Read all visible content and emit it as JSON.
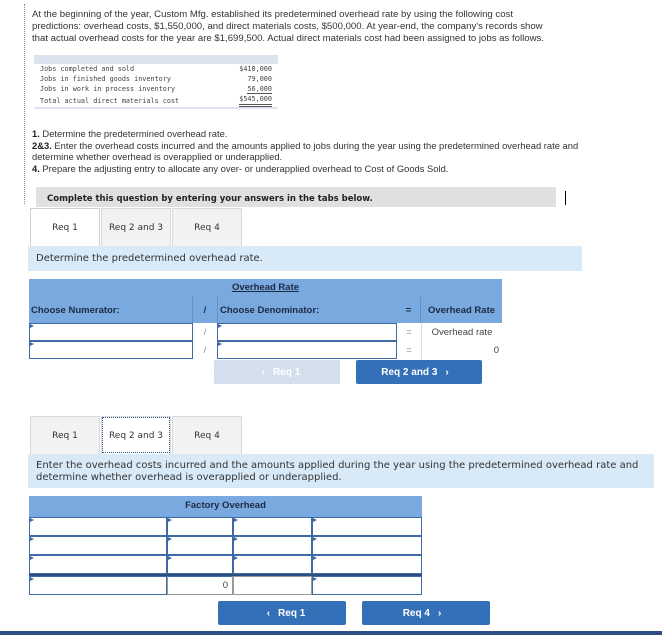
{
  "intro": "At the beginning of the year, Custom Mfg. established its predetermined overhead rate by using the following cost predictions: overhead costs, $1,550,000, and direct materials costs, $500,000. At year-end, the company's records show that actual overhead costs for the year are $1,699,500. Actual direct materials cost had been assigned to jobs as follows.",
  "materials": {
    "rows": [
      {
        "label": "Jobs completed and sold",
        "amount": "$410,000"
      },
      {
        "label": "Jobs in finished goods inventory",
        "amount": "79,000"
      },
      {
        "label": "Jobs in work in process inventory",
        "amount": "56,000"
      }
    ],
    "total": {
      "label": "Total actual direct materials cost",
      "amount": "$545,000"
    }
  },
  "requirements": [
    {
      "num": "1.",
      "text": " Determine the predetermined overhead rate."
    },
    {
      "num": "2&3.",
      "text": " Enter the overhead costs incurred and the amounts applied to jobs during the year using the predetermined overhead rate and determine whether overhead is overapplied or underapplied."
    },
    {
      "num": "4.",
      "text": " Prepare the adjusting entry to allocate any over- or underapplied overhead to Cost of Goods Sold."
    }
  ],
  "complete_bar": "Complete this question by entering your answers in the tabs below.",
  "tabs": [
    "Req 1",
    "Req 2 and 3",
    "Req 4"
  ],
  "req1": {
    "instruction": "Determine the predetermined overhead rate.",
    "table_title": "Overhead Rate",
    "col_numerator": "Choose Numerator:",
    "col_div": "/",
    "col_denominator": "Choose Denominator:",
    "col_eq": "=",
    "col_result": "Overhead Rate",
    "rows": [
      {
        "numerator": "",
        "denominator": "",
        "div": "/",
        "eq": "=",
        "result": "Overhead rate"
      },
      {
        "numerator": "",
        "denominator": "",
        "div": "/",
        "eq": "=",
        "result": "0"
      }
    ],
    "prev_button": "Req 1",
    "next_button": "Req 2 and 3"
  },
  "req23": {
    "instruction": "Enter the overhead costs incurred and the amounts applied during the year using the predetermined overhead rate and determine whether overhead is overapplied or underapplied.",
    "table_title": "Factory Overhead",
    "total_value": "0",
    "prev_button": "Req 1",
    "next_button": "Req 4"
  },
  "colors": {
    "header_blue": "#79a9df",
    "button_blue": "#3470b8",
    "instruction_bg": "#d8eaf8",
    "disabled_button": "#d4dfee"
  }
}
